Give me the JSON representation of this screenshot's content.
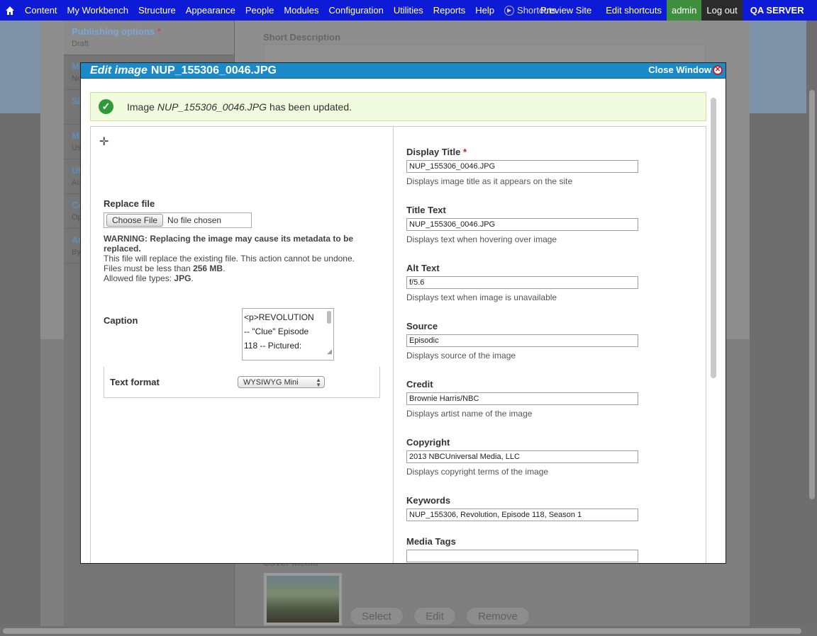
{
  "toolbar": {
    "items": [
      "Content",
      "My Workbench",
      "Structure",
      "Appearance",
      "People",
      "Modules",
      "Configuration",
      "Utilities",
      "Reports",
      "Help"
    ],
    "shortcuts_label": "Shortcuts",
    "preview_label": "Preview Site",
    "edit_shortcuts": "Edit shortcuts",
    "admin": "admin",
    "logout": "Log out",
    "server": "QA SERVER"
  },
  "background": {
    "sidebar_tabs": [
      {
        "title": "Publishing options",
        "sub": "Draft"
      },
      {
        "title": "M",
        "sub": "No"
      },
      {
        "title": "Si",
        "sub": ""
      },
      {
        "title": "M",
        "sub": "Us"
      },
      {
        "title": "UI",
        "sub": "Au"
      },
      {
        "title": "Co",
        "sub": "Op"
      },
      {
        "title": "Au",
        "sub": "By"
      }
    ],
    "short_description": "Short Description",
    "cover_media": "Cover Media",
    "buttons": {
      "select": "Select",
      "edit": "Edit",
      "remove": "Remove"
    }
  },
  "dialog": {
    "title_prefix": "Edit image",
    "title_file": "NUP_155306_0046.JPG",
    "close": "Close Window",
    "message": {
      "pre": "Image",
      "file": "NUP_155306_0046.JPG",
      "post": "has been updated."
    },
    "replace_file": {
      "label": "Replace file",
      "button": "Choose File",
      "status": "No file chosen",
      "warning": "WARNING: Replacing the image may cause its metadata to be replaced.",
      "info1": "This file will replace the existing file. This action cannot be undone.",
      "info2_pre": "Files must be less than",
      "info2_val": "256 MB",
      "info3_pre": "Allowed file types:",
      "info3_val": "JPG"
    },
    "caption": {
      "label": "Caption",
      "lines": [
        "<p>REVOLUTION",
        "-- \"Clue\" Episode",
        "118 -- Pictured:"
      ]
    },
    "text_format": {
      "label": "Text format",
      "value": "WYSIWYG Mini"
    },
    "fields": [
      {
        "label": "Display Title",
        "required": true,
        "value": "NUP_155306_0046.JPG",
        "desc": "Displays image title as it appears on the site"
      },
      {
        "label": "Title Text",
        "required": false,
        "value": "NUP_155306_0046.JPG",
        "desc": "Displays text when hovering over image"
      },
      {
        "label": "Alt Text",
        "required": false,
        "value": "f/5.6",
        "desc": "Displays text when image is unavailable"
      },
      {
        "label": "Source",
        "required": false,
        "value": "Episodic",
        "desc": "Displays source of the image"
      },
      {
        "label": "Credit",
        "required": false,
        "value": "Brownie Harris/NBC",
        "desc": "Displays artist name of the image"
      },
      {
        "label": "Copyright",
        "required": false,
        "value": "2013 NBCUniversal Media, LLC",
        "desc": "Displays copyright terms of the image"
      },
      {
        "label": "Keywords",
        "required": false,
        "value": "NUP_155306, Revolution, Episode 118, Season 1",
        "desc": ""
      },
      {
        "label": "Media Tags",
        "required": false,
        "value": "",
        "desc": ""
      }
    ]
  }
}
